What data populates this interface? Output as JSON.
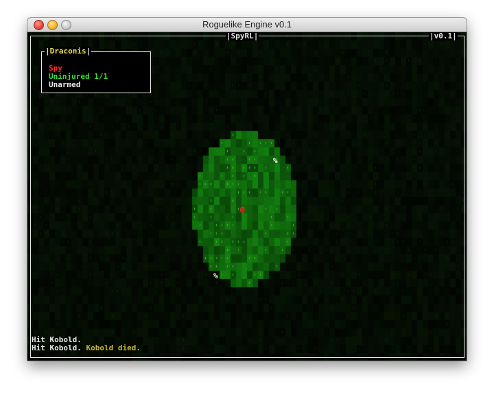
{
  "window": {
    "title": "Roguelike Engine v0.1"
  },
  "hud": {
    "game_title": "SpyRL",
    "version": "v0.1"
  },
  "character": {
    "name": "Draconis",
    "class": "Spy",
    "health": "Uninjured 1/1",
    "weapon": "Unarmed"
  },
  "map": {
    "player_glyph": "@",
    "corpse_glyph": "%",
    "grass_glyph": "\"",
    "colors": {
      "lit_grass": "#1e6a10",
      "dark_ground": "#0b1a08",
      "player": "#ff2a2a",
      "corpse": "#ffffff"
    }
  },
  "messages": [
    {
      "text": "Hit Kobold.",
      "extra": ""
    },
    {
      "text": "Hit Kobold.",
      "extra": "Kobold died."
    }
  ],
  "colors": {
    "class": "#ff2a2a",
    "health": "#33e033",
    "weapon": "#e8e8e8",
    "name": "#f4e04a",
    "death": "#c8b43a"
  }
}
